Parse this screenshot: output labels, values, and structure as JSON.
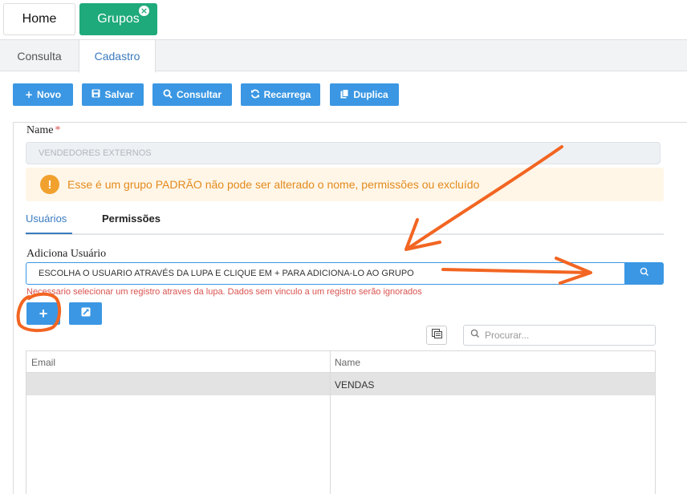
{
  "top_tabs": [
    {
      "label": "Home"
    },
    {
      "label": "Grupos"
    }
  ],
  "sub_tabs": [
    {
      "label": "Consulta"
    },
    {
      "label": "Cadastro"
    }
  ],
  "toolbar": {
    "novo": "Novo",
    "salvar": "Salvar",
    "consultar": "Consultar",
    "recarrega": "Recarrega",
    "duplica": "Duplica"
  },
  "form": {
    "name_label": "Name",
    "name_required": "*",
    "name_value": "VENDEDORES EXTERNOS",
    "alert_icon": "!",
    "alert_text": "Esse é um grupo PADRÃO não pode ser alterado o nome, permissões ou excluído",
    "tabs": [
      {
        "label": "Usuários"
      },
      {
        "label": "Permissões"
      }
    ],
    "adiciona_label": "Adiciona Usuário",
    "user_input_value": "ESCOLHA O USUARIO ATRAVÉS DA LUPA E CLIQUE EM + PARA ADICIONA-LO AO GRUPO",
    "hint": "Necessario selecionar um registro atraves da lupa. Dados sem vinculo a um registro serão ignorados",
    "add_button": "+",
    "search_placeholder": "Procurar..."
  },
  "grid": {
    "columns": [
      "Email",
      "Name"
    ],
    "rows": [
      {
        "email": "",
        "name": "VENDAS"
      }
    ]
  },
  "colors": {
    "primary": "#3b97e3",
    "tab_active": "#1eaa7a",
    "annotation": "#f26522",
    "warning": "#f1a12e",
    "error": "#d9534f"
  }
}
